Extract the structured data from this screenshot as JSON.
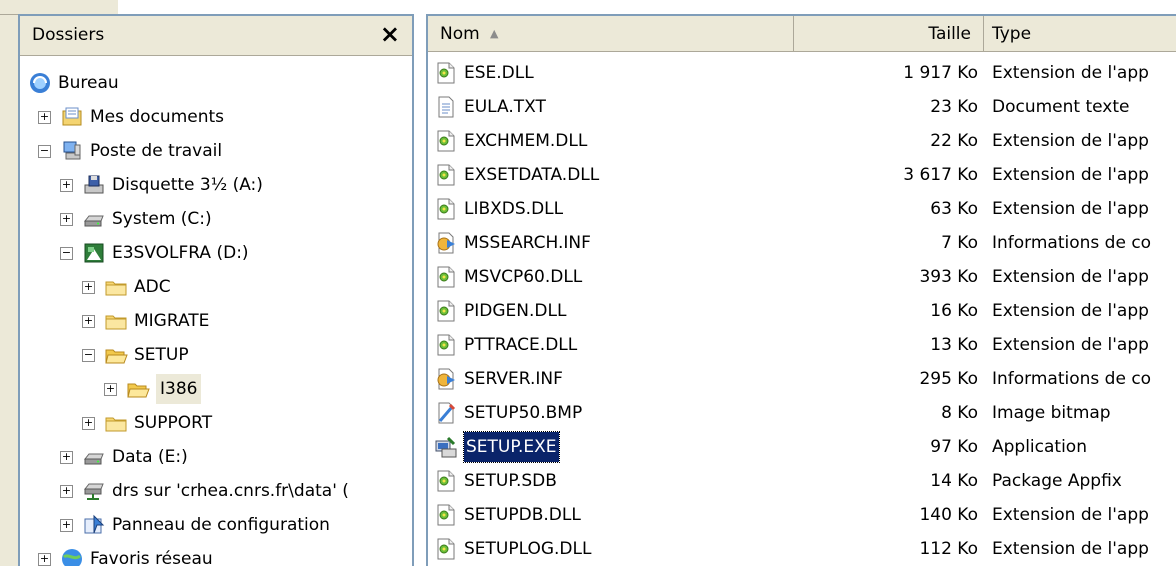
{
  "folders_pane": {
    "title": "Dossiers",
    "close_label": "×",
    "tree": [
      {
        "label": "Bureau",
        "icon": "desktop-icon",
        "expander": ""
      },
      {
        "label": "Mes documents",
        "icon": "my-documents-icon",
        "expander": "+"
      },
      {
        "label": "Poste de travail",
        "icon": "my-computer-icon",
        "expander": "−"
      },
      {
        "label": "Disquette 3½ (A:)",
        "icon": "floppy-drive-icon",
        "expander": "+"
      },
      {
        "label": "System (C:)",
        "icon": "hard-drive-icon",
        "expander": "+"
      },
      {
        "label": "E3SVOLFRA (D:)",
        "icon": "cd-drive-icon",
        "expander": "−"
      },
      {
        "label": "ADC",
        "icon": "folder-icon",
        "expander": "+"
      },
      {
        "label": "MIGRATE",
        "icon": "folder-icon",
        "expander": "+"
      },
      {
        "label": "SETUP",
        "icon": "open-folder-icon",
        "expander": "−"
      },
      {
        "label": "I386",
        "icon": "open-folder-icon",
        "expander": "+"
      },
      {
        "label": "SUPPORT",
        "icon": "folder-icon",
        "expander": "+"
      },
      {
        "label": "Data (E:)",
        "icon": "hard-drive-icon",
        "expander": "+"
      },
      {
        "label": "drs sur 'crhea.cnrs.fr\\data' (",
        "icon": "network-drive-icon",
        "expander": "+"
      },
      {
        "label": "Panneau de configuration",
        "icon": "control-panel-icon",
        "expander": "+"
      },
      {
        "label": "Favoris réseau",
        "icon": "network-places-icon",
        "expander": "+"
      }
    ]
  },
  "file_list": {
    "columns": {
      "name": "Nom",
      "sort_indicator": "▲",
      "size": "Taille",
      "type": "Type"
    },
    "rows": [
      {
        "name": "ESE.DLL",
        "size": "1 917 Ko",
        "type": "Extension de l'app",
        "icon": "dll-icon"
      },
      {
        "name": "EULA.TXT",
        "size": "23 Ko",
        "type": "Document texte",
        "icon": "text-file-icon"
      },
      {
        "name": "EXCHMEM.DLL",
        "size": "22 Ko",
        "type": "Extension de l'app",
        "icon": "dll-icon"
      },
      {
        "name": "EXSETDATA.DLL",
        "size": "3 617 Ko",
        "type": "Extension de l'app",
        "icon": "dll-icon"
      },
      {
        "name": "LIBXDS.DLL",
        "size": "63 Ko",
        "type": "Extension de l'app",
        "icon": "dll-icon"
      },
      {
        "name": "MSSEARCH.INF",
        "size": "7 Ko",
        "type": "Informations de co",
        "icon": "inf-file-icon"
      },
      {
        "name": "MSVCP60.DLL",
        "size": "393 Ko",
        "type": "Extension de l'app",
        "icon": "dll-icon"
      },
      {
        "name": "PIDGEN.DLL",
        "size": "16 Ko",
        "type": "Extension de l'app",
        "icon": "dll-icon"
      },
      {
        "name": "PTTRACE.DLL",
        "size": "13 Ko",
        "type": "Extension de l'app",
        "icon": "dll-icon"
      },
      {
        "name": "SERVER.INF",
        "size": "295 Ko",
        "type": "Informations de co",
        "icon": "inf-file-icon"
      },
      {
        "name": "SETUP50.BMP",
        "size": "8 Ko",
        "type": "Image bitmap",
        "icon": "bitmap-icon"
      },
      {
        "name": "SETUP.EXE",
        "size": "97 Ko",
        "type": "Application",
        "icon": "setup-exe-icon",
        "selected": true
      },
      {
        "name": "SETUP.SDB",
        "size": "14 Ko",
        "type": "Package Appfix",
        "icon": "dll-icon"
      },
      {
        "name": "SETUPDB.DLL",
        "size": "140 Ko",
        "type": "Extension de l'app",
        "icon": "dll-icon"
      },
      {
        "name": "SETUPLOG.DLL",
        "size": "112 Ko",
        "type": "Extension de l'app",
        "icon": "dll-icon"
      }
    ]
  }
}
